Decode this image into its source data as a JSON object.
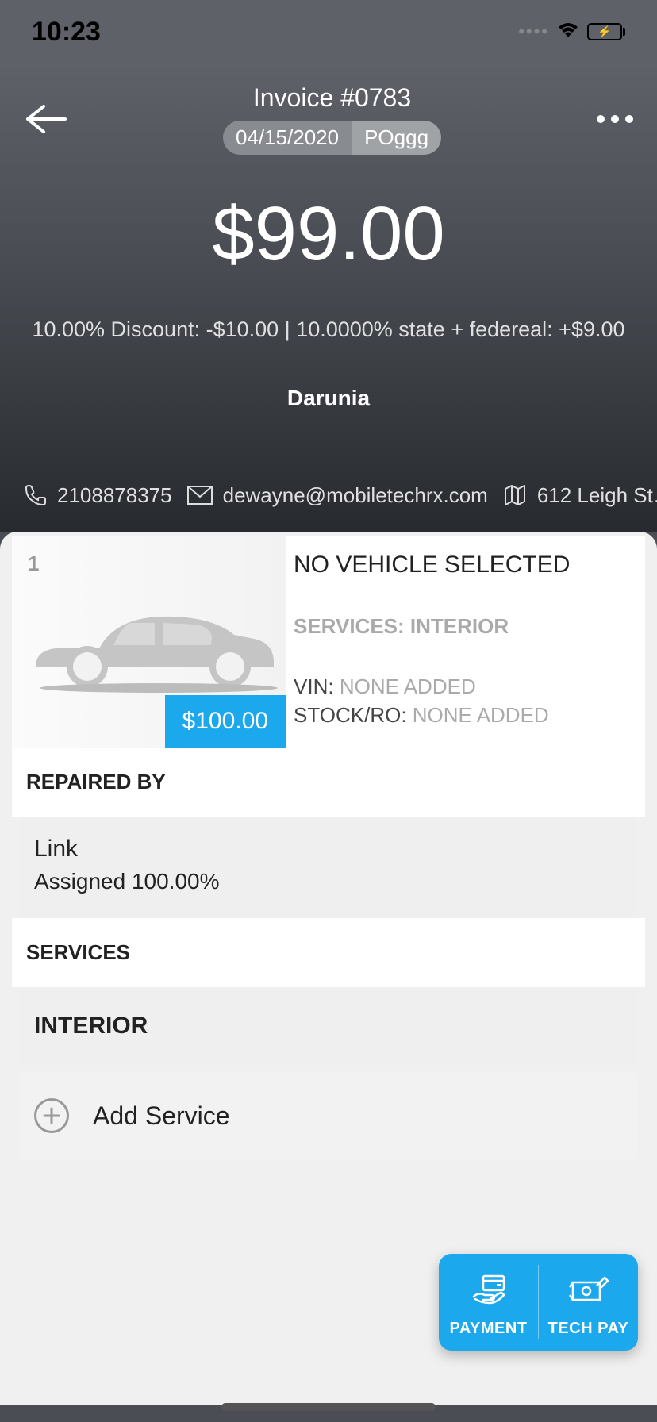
{
  "status": {
    "time": "10:23"
  },
  "header": {
    "title": "Invoice #0783",
    "date": "04/15/2020",
    "po": "POggg",
    "amount": "$99.00",
    "discount_line": "10.00% Discount: -$10.00 | 10.0000% state + federeal: +$9.00",
    "customer": "Darunia"
  },
  "contact": {
    "phone": "2108878375",
    "email": "dewayne@mobiletechrx.com",
    "address": "612 Leigh St…"
  },
  "vehicle": {
    "index": "1",
    "price": "$100.00",
    "title": "NO VEHICLE SELECTED",
    "services_label": "SERVICES: INTERIOR",
    "vin_label": "VIN:",
    "vin_value": "NONE ADDED",
    "stock_label": "STOCK/RO:",
    "stock_value": "NONE ADDED"
  },
  "sections": {
    "repaired_by": "REPAIRED BY",
    "repairer_name": "Link",
    "repairer_assigned": "Assigned 100.00%",
    "services": "SERVICES",
    "service_category": "INTERIOR",
    "add_service": "Add Service"
  },
  "fab": {
    "payment": "PAYMENT",
    "techpay": "TECH PAY"
  }
}
